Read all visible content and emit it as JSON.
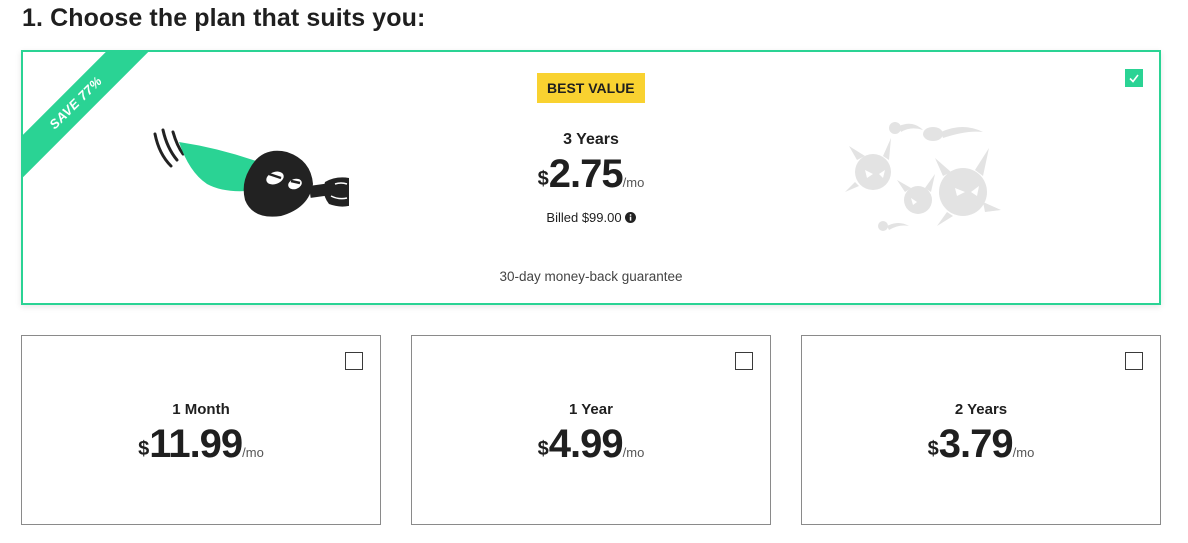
{
  "heading": "1. Choose the plan that suits you:",
  "featured": {
    "ribbon": "SAVE 77%",
    "badge": "BEST VALUE",
    "title": "3 Years",
    "currency": "$",
    "amount": "2.75",
    "per": "/mo",
    "billed": "Billed $99.00",
    "guarantee": "30-day money-back guarantee",
    "checked": true
  },
  "plans": [
    {
      "title": "1 Month",
      "currency": "$",
      "amount": "11.99",
      "per": "/mo",
      "checked": false
    },
    {
      "title": "1 Year",
      "currency": "$",
      "amount": "4.99",
      "per": "/mo",
      "checked": false
    },
    {
      "title": "2 Years",
      "currency": "$",
      "amount": "3.79",
      "per": "/mo",
      "checked": false
    }
  ],
  "colors": {
    "accent": "#2ad394",
    "badge": "#f9d230",
    "text": "#1f1f1f",
    "illustration_dark": "#222222",
    "illustration_ghost": "#e3e3e3"
  },
  "icons": {
    "hero": "masked-hero-punch-illustration",
    "monsters": "virus-monsters-illustration",
    "check": "checkmark-icon",
    "info": "info-icon"
  }
}
